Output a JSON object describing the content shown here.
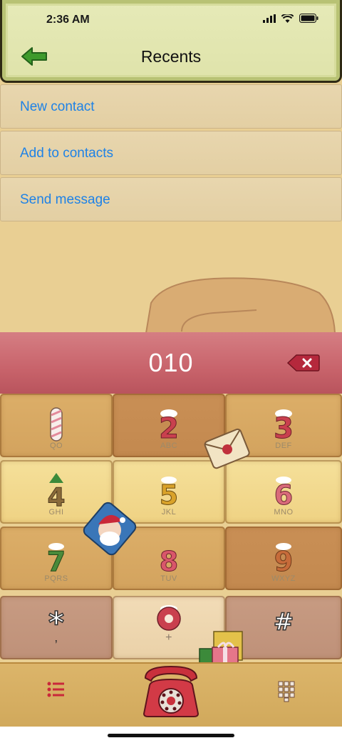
{
  "status_bar": {
    "time": "2:36 AM"
  },
  "header": {
    "title": "Recents"
  },
  "menu": [
    {
      "label": "New contact"
    },
    {
      "label": "Add to contacts"
    },
    {
      "label": "Send message"
    }
  ],
  "dialer": {
    "number": "010",
    "keys": [
      {
        "digit": "1",
        "letters": "QO"
      },
      {
        "digit": "2",
        "letters": "ABC"
      },
      {
        "digit": "3",
        "letters": "DEF"
      },
      {
        "digit": "4",
        "letters": "GHI"
      },
      {
        "digit": "5",
        "letters": "JKL"
      },
      {
        "digit": "6",
        "letters": "MNO"
      },
      {
        "digit": "7",
        "letters": "PQRS"
      },
      {
        "digit": "8",
        "letters": "TUV"
      },
      {
        "digit": "9",
        "letters": "WXYZ"
      },
      {
        "digit": "*",
        "letters": ","
      },
      {
        "digit": "0",
        "letters": "+"
      },
      {
        "digit": "#",
        "letters": ""
      }
    ]
  },
  "icons": {
    "back": "arrow-left-icon",
    "backspace": "backspace-icon",
    "menu": "list-icon",
    "call": "rotary-phone-icon",
    "keypad_toggle": "keypad-icon"
  },
  "colors": {
    "accent": "#1e82e6",
    "display": "#c8636b",
    "header": "#e2e6b0"
  }
}
